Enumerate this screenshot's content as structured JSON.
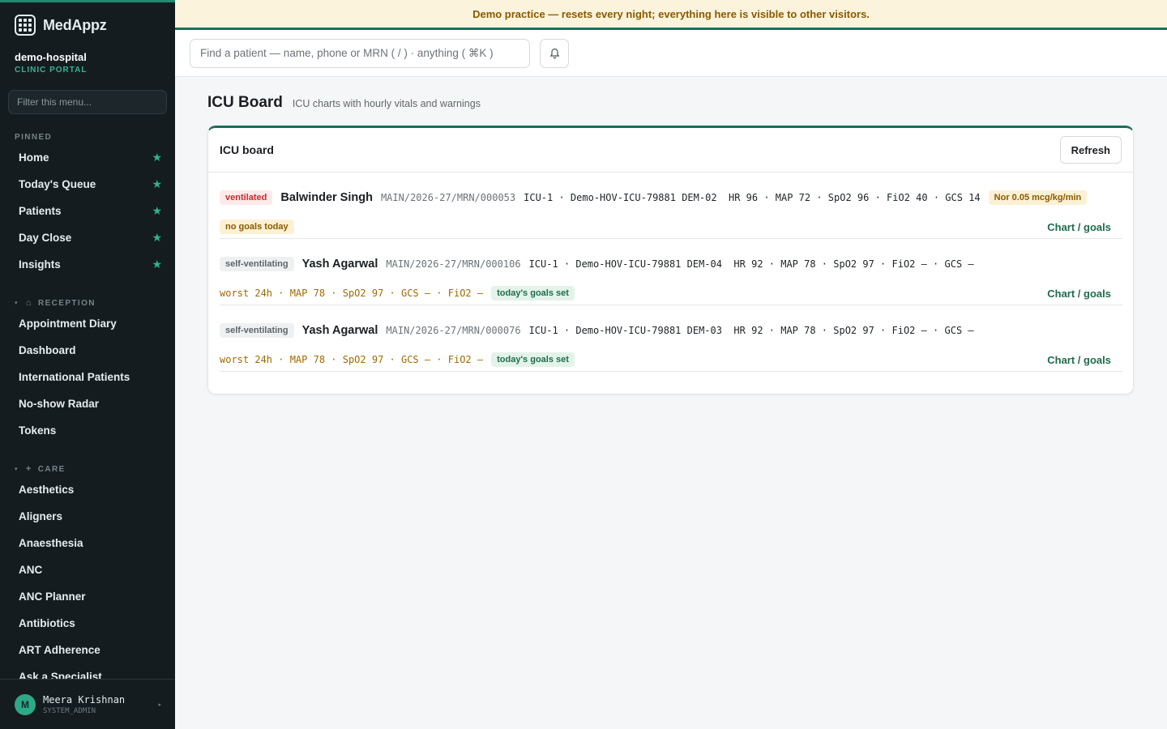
{
  "app": {
    "brand": "MedAppz",
    "org_name": "demo-hospital",
    "org_sub": "CLINIC PORTAL"
  },
  "banner": "Demo practice — resets every night; everything here is visible to other visitors.",
  "sidebar": {
    "filter_placeholder": "Filter this menu...",
    "pinned_label": "PINNED",
    "pinned": [
      {
        "label": "Home"
      },
      {
        "label": "Today's Queue"
      },
      {
        "label": "Patients"
      },
      {
        "label": "Day Close"
      },
      {
        "label": "Insights"
      }
    ],
    "reception_label": "RECEPTION",
    "reception": [
      {
        "label": "Appointment Diary"
      },
      {
        "label": "Dashboard"
      },
      {
        "label": "International Patients"
      },
      {
        "label": "No-show Radar"
      },
      {
        "label": "Tokens"
      }
    ],
    "care_label": "CARE",
    "care": [
      {
        "label": "Aesthetics"
      },
      {
        "label": "Aligners"
      },
      {
        "label": "Anaesthesia"
      },
      {
        "label": "ANC"
      },
      {
        "label": "ANC Planner"
      },
      {
        "label": "Antibiotics"
      },
      {
        "label": "ART Adherence"
      },
      {
        "label": "Ask a Specialist"
      }
    ],
    "user": {
      "initial": "M",
      "name": "Meera Krishnan",
      "role": "SYSTEM_ADMIN"
    }
  },
  "topbar": {
    "search_placeholder": "Find a patient — name, phone or MRN ( / ) · anything ( ⌘K )"
  },
  "page": {
    "title": "ICU Board",
    "subtitle": "ICU charts with hourly vitals and warnings"
  },
  "board": {
    "title": "ICU board",
    "refresh_label": "Refresh",
    "chart_link_label": "Chart / goals",
    "rows": [
      {
        "status": "ventilated",
        "name": "Balwinder Singh",
        "mrn": "MAIN/2026-27/MRN/000053",
        "vitals": "ICU-1 · Demo-HOV-ICU-79881 DEM-02  HR 96 · MAP 72 · SpO2 96 · FiO2 40 · GCS 14",
        "drug": "Nor 0.05 mcg/kg/min",
        "worst": "",
        "goals": "no goals today"
      },
      {
        "status": "self-ventilating",
        "name": "Yash Agarwal",
        "mrn": "MAIN/2026-27/MRN/000106",
        "vitals": "ICU-1 · Demo-HOV-ICU-79881 DEM-04  HR 92 · MAP 78 · SpO2 97 · FiO2 — · GCS —",
        "drug": "",
        "worst": "worst 24h · MAP 78 · SpO2 97 · GCS — · FiO2 —",
        "goals": "today's goals set"
      },
      {
        "status": "self-ventilating",
        "name": "Yash Agarwal",
        "mrn": "MAIN/2026-27/MRN/000076",
        "vitals": "ICU-1 · Demo-HOV-ICU-79881 DEM-03  HR 92 · MAP 78 · SpO2 97 · FiO2 — · GCS —",
        "drug": "",
        "worst": "worst 24h · MAP 78 · SpO2 97 · GCS — · FiO2 —",
        "goals": "today's goals set"
      }
    ]
  }
}
